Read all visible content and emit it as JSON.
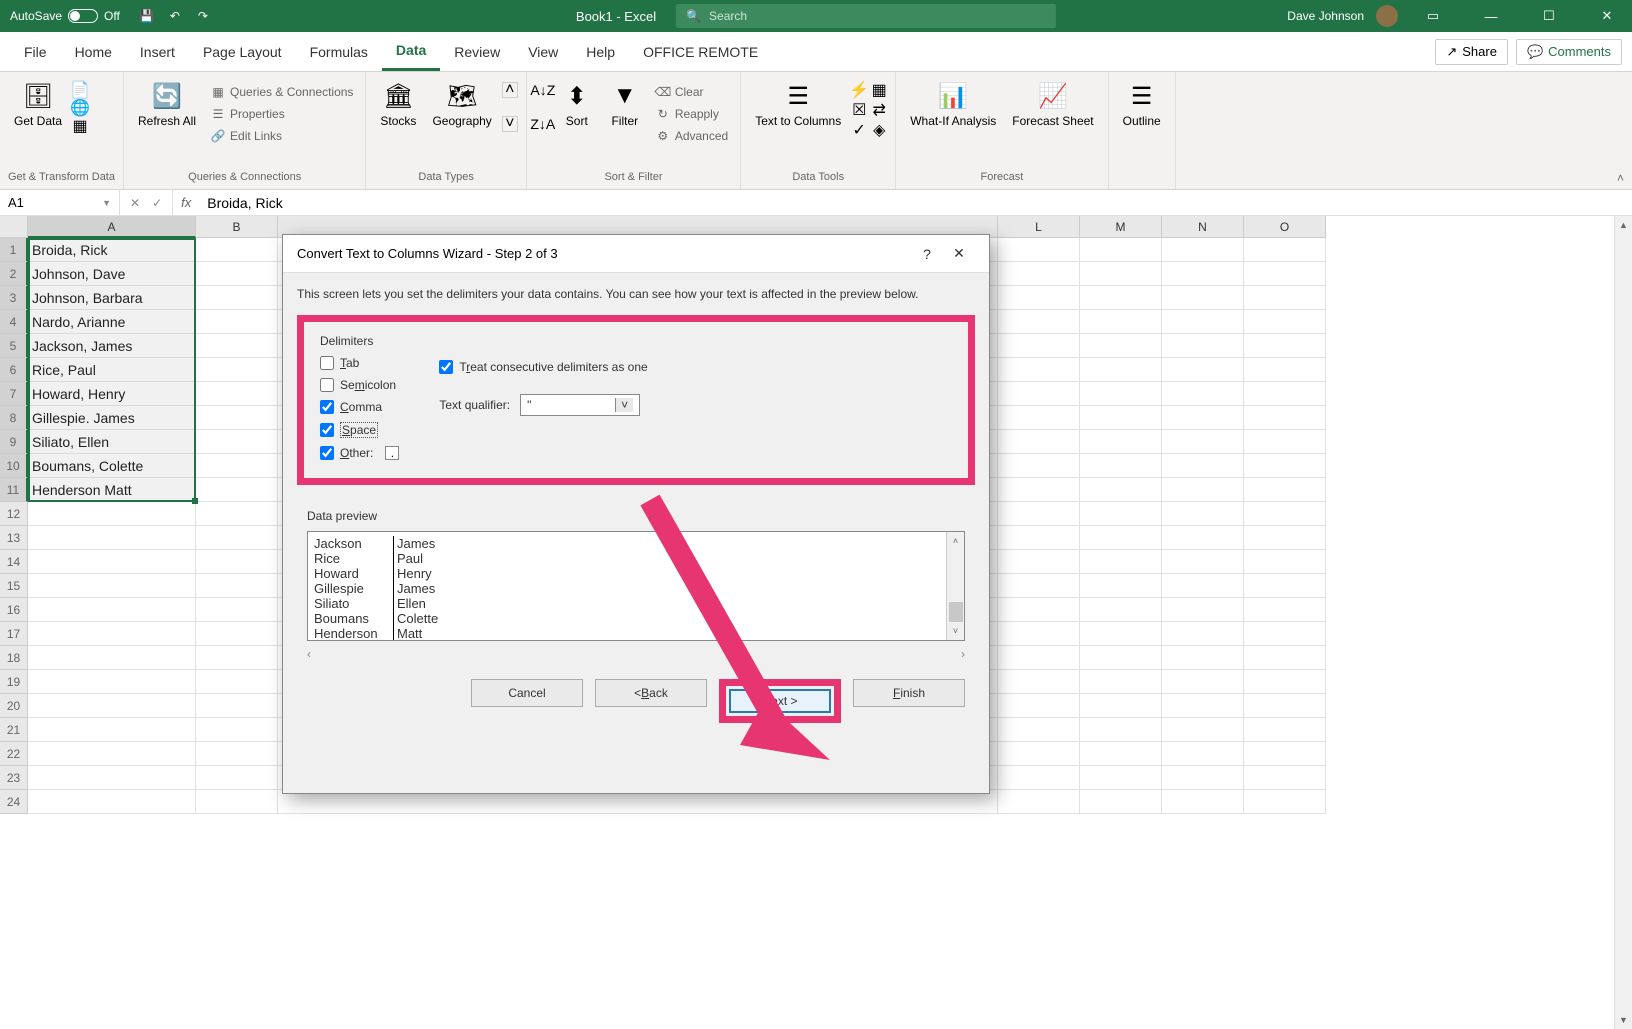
{
  "titlebar": {
    "autosave_label": "AutoSave",
    "autosave_state": "Off",
    "doc_title": "Book1 - Excel",
    "search_placeholder": "Search",
    "user": "Dave Johnson"
  },
  "tabs": [
    "File",
    "Home",
    "Insert",
    "Page Layout",
    "Formulas",
    "Data",
    "Review",
    "View",
    "Help",
    "OFFICE REMOTE"
  ],
  "active_tab": "Data",
  "ribbon_right": {
    "share": "Share",
    "comments": "Comments"
  },
  "ribbon": {
    "groups": [
      {
        "label": "Get & Transform Data",
        "large": [
          {
            "text": "Get Data"
          }
        ]
      },
      {
        "label": "Queries & Connections",
        "large": [
          {
            "text": "Refresh All"
          }
        ],
        "small": [
          "Queries & Connections",
          "Properties",
          "Edit Links"
        ]
      },
      {
        "label": "Data Types",
        "large": [
          {
            "text": "Stocks"
          },
          {
            "text": "Geography"
          }
        ]
      },
      {
        "label": "Sort & Filter",
        "large": [
          {
            "text": "Sort"
          },
          {
            "text": "Filter"
          }
        ],
        "small": [
          "Clear",
          "Reapply",
          "Advanced"
        ]
      },
      {
        "label": "Data Tools",
        "large": [
          {
            "text": "Text to Columns"
          }
        ]
      },
      {
        "label": "Forecast",
        "large": [
          {
            "text": "What-If Analysis"
          },
          {
            "text": "Forecast Sheet"
          }
        ]
      },
      {
        "label": "",
        "large": [
          {
            "text": "Outline"
          }
        ]
      }
    ]
  },
  "formula_bar": {
    "name_box": "A1",
    "fx": "fx",
    "value": "Broida, Rick"
  },
  "columns": [
    "A",
    "B",
    "L",
    "M",
    "N",
    "O"
  ],
  "row_numbers": [
    1,
    2,
    3,
    4,
    5,
    6,
    7,
    8,
    9,
    10,
    11,
    12,
    13,
    14,
    15,
    16,
    17,
    18,
    19,
    20,
    21,
    22,
    23,
    24
  ],
  "cell_data": [
    "Broida, Rick",
    "Johnson, Dave",
    "Johnson, Barbara",
    "Nardo, Arianne",
    "Jackson, James",
    "Rice, Paul",
    "Howard, Henry",
    "Gillespie. James",
    "Siliato, Ellen",
    "Boumans, Colette",
    "Henderson Matt"
  ],
  "dialog": {
    "title": "Convert Text to Columns Wizard - Step 2 of 3",
    "description": "This screen lets you set the delimiters your data contains.  You can see how your text is affected in the preview below.",
    "delimiters_label": "Delimiters",
    "delimiters": {
      "tab": {
        "label": "Tab",
        "checked": false
      },
      "semicolon": {
        "label": "Semicolon",
        "checked": false
      },
      "comma": {
        "label": "Comma",
        "checked": true
      },
      "space": {
        "label": "Space",
        "checked": true
      },
      "other": {
        "label": "Other:",
        "checked": true,
        "value": "."
      }
    },
    "treat_consecutive": {
      "label": "Treat consecutive delimiters as one",
      "checked": true
    },
    "text_qualifier_label": "Text qualifier:",
    "text_qualifier_value": "\"",
    "preview_label": "Data preview",
    "preview_rows": [
      [
        "Jackson",
        "James"
      ],
      [
        "Rice",
        "Paul"
      ],
      [
        "Howard",
        "Henry"
      ],
      [
        "Gillespie",
        "James"
      ],
      [
        "Siliato",
        "Ellen"
      ],
      [
        "Boumans",
        "Colette"
      ],
      [
        "Henderson",
        "Matt"
      ]
    ],
    "buttons": {
      "cancel": "Cancel",
      "back": "< Back",
      "next": "Next >",
      "finish": "Finish"
    }
  }
}
